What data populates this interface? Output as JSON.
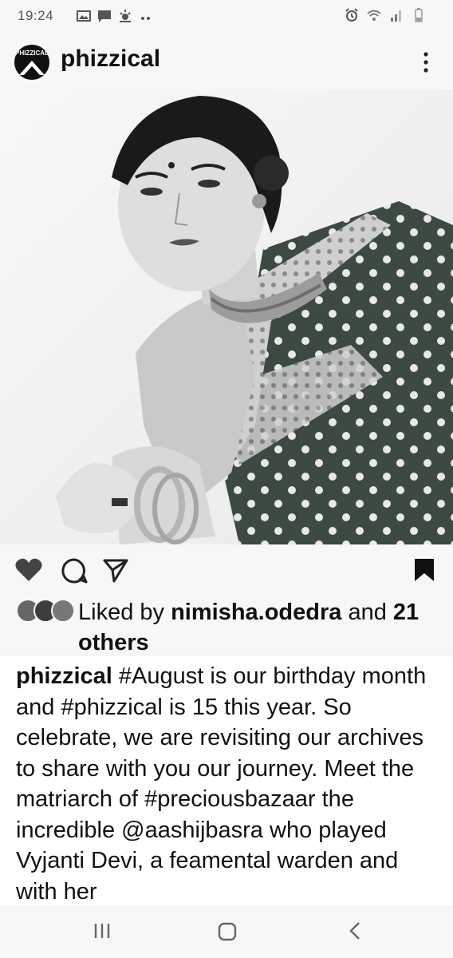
{
  "status_bar": {
    "time": "19:24",
    "left_icons": [
      "gallery-icon",
      "message-icon",
      "weather-icon",
      "more-dots-icon"
    ],
    "right_icons": [
      "alarm-icon",
      "wifi-icon",
      "signal-icon",
      "battery-icon"
    ]
  },
  "post": {
    "username": "phizzical",
    "avatar_text": "PHIZZICAL",
    "image_icon": "portrait-photo",
    "likes": {
      "prefix": "Liked by",
      "user": "nimisha.odedra",
      "connector": "and",
      "others": "21 others"
    },
    "caption": {
      "user": "phizzical",
      "text": "#August is our birthday month and #phizzical is 15 this year. So celebrate, we are revisiting our archives to share with you our journey. Meet the matriarch of #preciousbazaar the incredible @aashijbasra who played Vyjanti Devi, a feamental warden and with her"
    }
  },
  "colors": {
    "background": "#f7f7f7",
    "text": "#111111",
    "icon_muted": "#555555",
    "heart": "#444444"
  },
  "nav": {
    "icons": [
      "recent-apps-icon",
      "home-icon",
      "back-icon"
    ]
  }
}
